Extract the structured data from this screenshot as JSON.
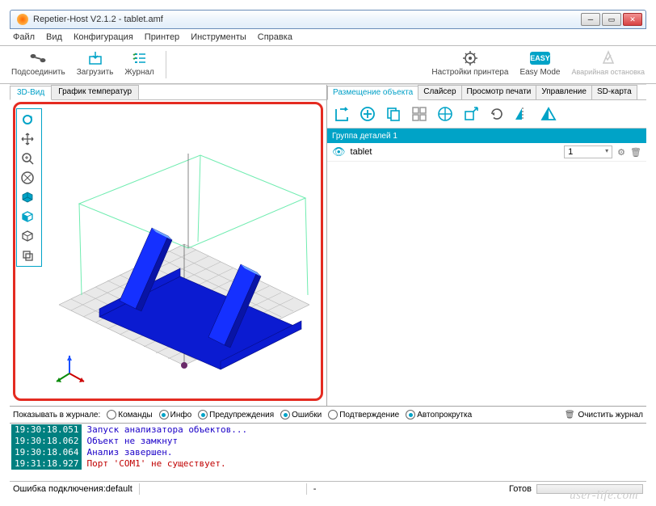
{
  "title": "Repetier-Host V2.1.2 - tablet.amf",
  "menu": {
    "file": "Файл",
    "view": "Вид",
    "config": "Конфигурация",
    "printer": "Принтер",
    "tools": "Инструменты",
    "help": "Справка"
  },
  "toolbar": {
    "connect": "Подсоединить",
    "load": "Загрузить",
    "log": "Журнал",
    "printer_settings": "Настройки принтера",
    "easy_mode": "Easy Mode",
    "easy_badge": "EASY",
    "emergency": "Аварийная остановка"
  },
  "left_tabs": {
    "view3d": "3D-Вид",
    "temp": "График температур"
  },
  "right_tabs": {
    "placement": "Размещение объекта",
    "slicer": "Слайсер",
    "print_preview": "Просмотр печати",
    "control": "Управление",
    "sdcard": "SD-карта"
  },
  "objects": {
    "group_title": "Группа деталей 1",
    "row": {
      "name": "tablet",
      "count": "1"
    }
  },
  "logfilter": {
    "label": "Показывать в журнале:",
    "cmd": "Команды",
    "info": "Инфо",
    "warn": "Предупреждения",
    "err": "Ошибки",
    "ack": "Подтверждение",
    "autoscroll": "Автопрокрутка",
    "clear": "Очистить журнал"
  },
  "loglines": [
    {
      "ts": "19:30:18.051",
      "msg": "Запуск анализатора объектов...",
      "err": false
    },
    {
      "ts": "19:30:18.062",
      "msg": "Объект не замкнут",
      "err": false
    },
    {
      "ts": "19:30:18.064",
      "msg": "Анализ завершен.",
      "err": false
    },
    {
      "ts": "19:31:18.927",
      "msg": "Порт 'COM1' не существует.",
      "err": true
    }
  ],
  "status": {
    "conn": "Ошибка подключения:default",
    "dash": "-",
    "ready": "Готов"
  },
  "watermark": "user-life.com"
}
